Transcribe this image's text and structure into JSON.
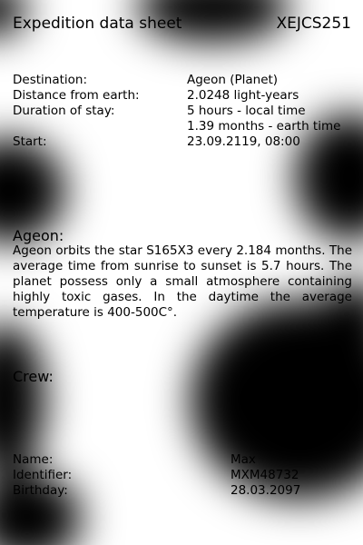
{
  "header": {
    "title": "Expedition data sheet",
    "code": "XEJCS251"
  },
  "details": [
    {
      "label": "Destination:",
      "value": "Ageon (Planet)"
    },
    {
      "label": "Distance from earth:",
      "value": "2.0248 light-years"
    },
    {
      "label": "Duration of stay:",
      "value": "5 hours - local time"
    },
    {
      "label": "",
      "value": "1.39 months - earth time"
    },
    {
      "label": "Start:",
      "value": "23.09.2119, 08:00"
    }
  ],
  "planet": {
    "heading": "Ageon:",
    "description": "Ageon orbits the star S165X3 every 2.184 months. The average time from sunrise to sunset is 5.7 hours. The planet possess only a small atmosphere containing highly toxic gases. In the daytime the average temperature is 400-500C°."
  },
  "crew": {
    "heading": "Crew:",
    "fields": [
      {
        "label": "Name:",
        "value": "Max"
      },
      {
        "label": "Identifier:",
        "value": "MXM48732"
      },
      {
        "label": "Birthday:",
        "value": "28.03.2097"
      }
    ]
  }
}
